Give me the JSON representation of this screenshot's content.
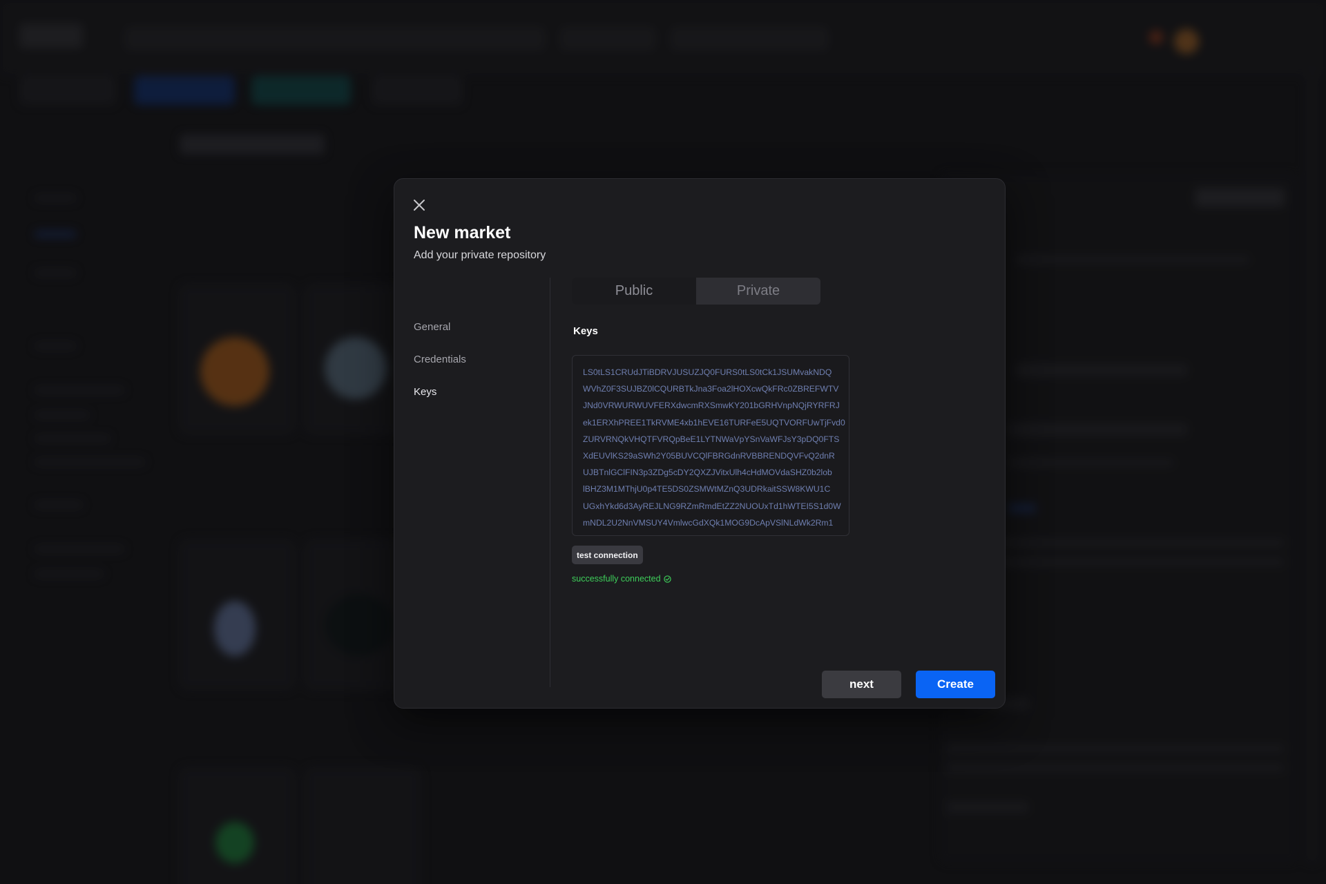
{
  "modal": {
    "title": "New market",
    "subtitle": "Add your private repository",
    "close_icon": "close-icon",
    "steps": [
      {
        "label": "General"
      },
      {
        "label": "Credentials"
      },
      {
        "label": "Keys",
        "active": true
      }
    ],
    "visibility_toggle": {
      "options": [
        "Public",
        "Private"
      ],
      "selected": "Public"
    },
    "keys_label": "Keys",
    "key_lines": [
      "LS0tLS1CRUdJTiBDRVJUSUZJQ0FURS0tLS0tCk1JSUMvakNDQ",
      "WVhZ0F3SUJBZ0lCQURBTkJna3Foa2lHOXcwQkFRc0ZBREFWTV",
      "JNd0VRWURWUVFERXdwcmRXSmwKY201bGRHVnpNQjRYRFRJ",
      "ek1ERXhPREE1TkRVME4xb1hEVE16TURFeE5UQTVORFUwTjFvd0",
      "ZURVRNQkVHQTFVRQpBeE1LYTNWaVpYSnVaWFJsY3pDQ0FTS",
      "XdEUVlKS29aSWh2Y05BUVCQlFBRGdnRVBBRENDQVFvQ2dnR",
      "UJBTnlGClFIN3p3ZDg5cDY2QXZJVitxUlh4cHdMOVdaSHZ0b2lob",
      "lBHZ3M1MThjU0p4TE5DS0ZSMWtMZnQ3UDRkaitSSW8KWU1C",
      "UGxhYkd6d3AyREJLNG9RZmRmdEtZZ2NUOUxTd1hWTEI5S1d0W",
      "mNDL2U2NnVMSUY4VmlwcGdXQk1MOG9DcApVSlNLdWk2Rm1"
    ],
    "test_button": "test connection",
    "status_text": "successfully connected",
    "status_icon": "check-circle-icon",
    "status_color": "#3ecf5a",
    "next_button": "next",
    "create_button": "Create",
    "accent_color": "#0a64f4"
  }
}
